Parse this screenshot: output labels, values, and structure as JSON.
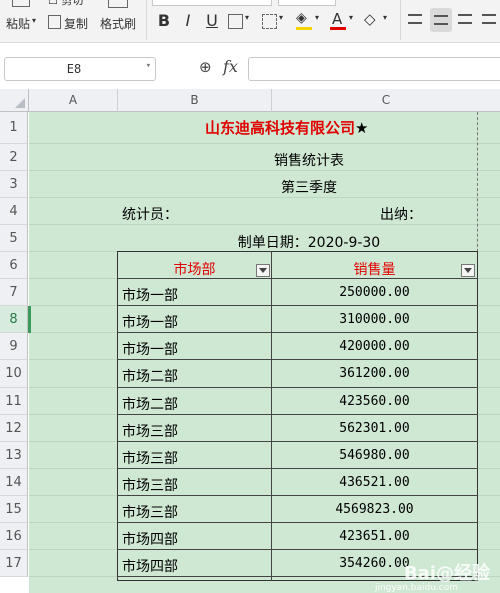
{
  "ribbon": {
    "paste_label": "粘贴",
    "copy_label": "复制",
    "format_painter_label": "格式刷",
    "bold": "B",
    "italic": "I",
    "underline": "U",
    "font_color_glyph": "A"
  },
  "formula_bar": {
    "name_box": "E8",
    "zoom_icon": "zoom-icon",
    "fx_label": "fx",
    "formula": ""
  },
  "columns": [
    "A",
    "B",
    "C"
  ],
  "rows": [
    "1",
    "2",
    "3",
    "4",
    "5",
    "6",
    "7",
    "8",
    "9",
    "10",
    "11",
    "12",
    "13",
    "14",
    "15",
    "16",
    "17"
  ],
  "active_row": "8",
  "sheet": {
    "company": "山东迪高科技有限公司",
    "title_star": "★",
    "report_title": "销售统计表",
    "quarter": "第三季度",
    "statistician": "统计员：",
    "cashier": "出纳：",
    "date_line": "制单日期：2020-9-30",
    "header_dept": "市场部",
    "header_sales": "销售量",
    "records": [
      {
        "dept": "市场一部",
        "sales": "250000.00"
      },
      {
        "dept": "市场一部",
        "sales": "310000.00"
      },
      {
        "dept": "市场一部",
        "sales": "420000.00"
      },
      {
        "dept": "市场二部",
        "sales": "361200.00"
      },
      {
        "dept": "市场二部",
        "sales": "423560.00"
      },
      {
        "dept": "市场三部",
        "sales": "562301.00"
      },
      {
        "dept": "市场三部",
        "sales": "546980.00"
      },
      {
        "dept": "市场三部",
        "sales": "436521.00"
      },
      {
        "dept": "市场三部",
        "sales": "4569823.00"
      },
      {
        "dept": "市场四部",
        "sales": "423651.00"
      },
      {
        "dept": "市场四部",
        "sales": "354260.00"
      }
    ]
  },
  "watermark": {
    "text": "Bai@经验",
    "sub": "jingyan.baidu.com"
  },
  "colors": {
    "sheet_bg": "#cfe8d4",
    "accent_red": "#e00000",
    "header_bg": "#eef0f3"
  }
}
